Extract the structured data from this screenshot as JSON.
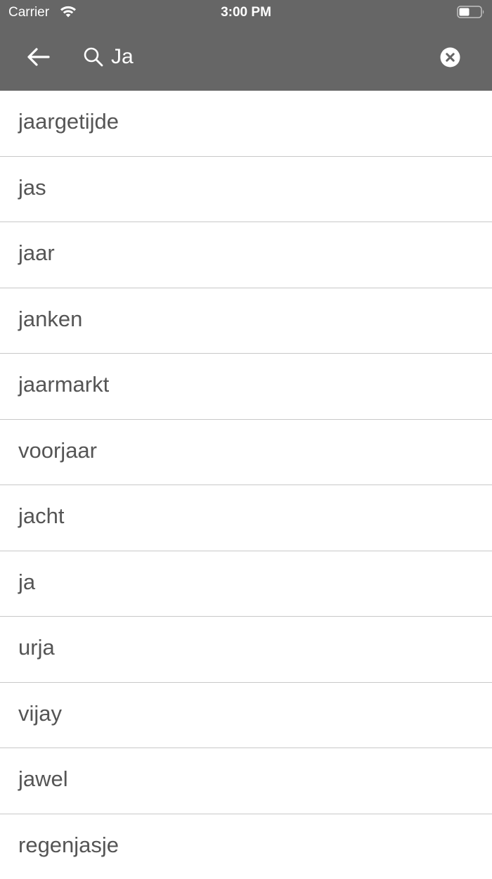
{
  "status_bar": {
    "carrier": "Carrier",
    "time": "3:00 PM",
    "wifi_icon": "wifi-icon",
    "battery_icon": "battery-icon"
  },
  "search": {
    "value": "Ja",
    "back_icon": "arrow-left-icon",
    "search_icon": "search-icon",
    "clear_icon": "clear-circle-icon"
  },
  "results": [
    "jaargetijde",
    "jas",
    "jaar",
    "janken",
    "jaarmarkt",
    "voorjaar",
    "jacht",
    "ja",
    "urja",
    "vijay",
    "jawel",
    "regenjasje"
  ],
  "colors": {
    "header_bg": "#666666",
    "text": "#555555",
    "divider": "#c8c8c8"
  }
}
